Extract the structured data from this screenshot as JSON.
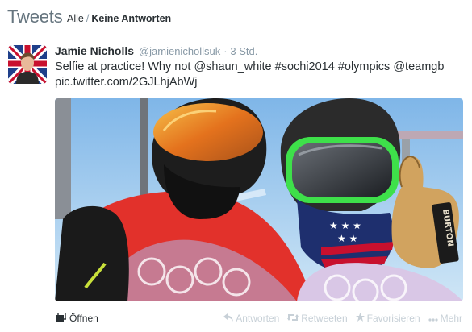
{
  "header": {
    "title": "Tweets",
    "filter_all": "Alle",
    "separator": "/",
    "filter_no_replies": "Keine Antworten"
  },
  "tweet": {
    "name": "Jamie Nicholls",
    "handle": "@jamienichollsuk",
    "dot": "·",
    "time": "3 Std.",
    "text_line1": "Selfie at practice! Why not @shaun_white #sochi2014 #olympics @teamgb",
    "text_line2": "pic.twitter.com/2GJLhjAbWj",
    "image_text": "BURTON"
  },
  "footer": {
    "open_label": "Öffnen",
    "reply_label": "Antworten",
    "retweet_label": "Retweeten",
    "favorite_label": "Favorisieren",
    "more_label": "Mehr"
  },
  "colors": {
    "text": "#292f33",
    "muted": "#8899a6",
    "action_gray": "#c7d0d7",
    "goggle_green": "#3ee04a",
    "jacket_red": "#e2312b"
  },
  "icons": {
    "open": "media-stack-icon",
    "reply": "reply-arrow-icon",
    "retweet": "retweet-icon",
    "favorite": "star-icon",
    "more": "ellipsis-icon"
  }
}
